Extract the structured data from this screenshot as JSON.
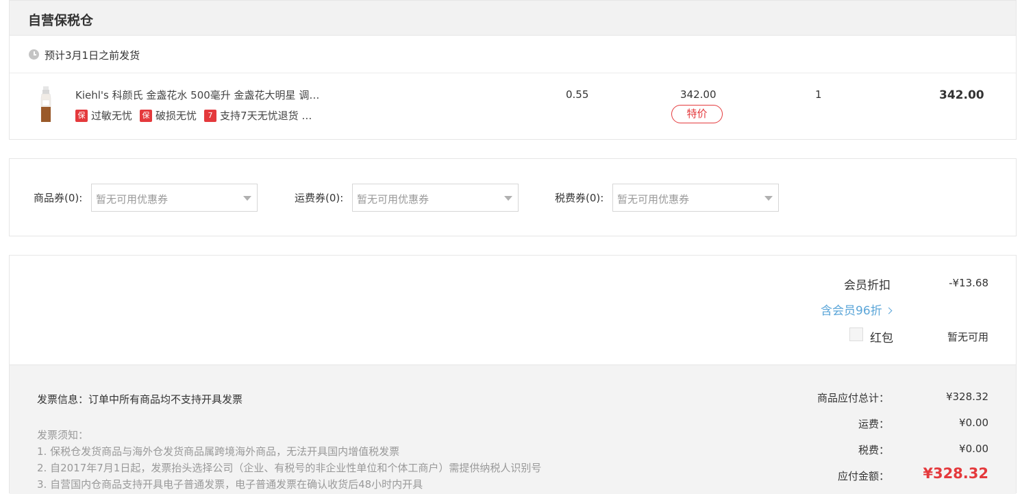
{
  "warehouse": {
    "title": "自营保税仓",
    "shipping_estimate": "预计3月1日之前发货"
  },
  "product": {
    "name": "Kiehl's 科颜氏 金盏花水 500毫升 金盏花大明星 调…",
    "tags": [
      {
        "badge": "保",
        "label": "过敏无忧"
      },
      {
        "badge": "保",
        "label": "破损无忧"
      },
      {
        "badge": "7",
        "label": "支持7天无忧退货 …"
      }
    ],
    "tax_rate": "0.55",
    "unit_price": "342.00",
    "special_badge": "特价",
    "quantity": "1",
    "subtotal": "342.00"
  },
  "coupons": [
    {
      "label": "商品券(0):",
      "placeholder": "暂无可用优惠券"
    },
    {
      "label": "运费券(0):",
      "placeholder": "暂无可用优惠券"
    },
    {
      "label": "税费券(0):",
      "placeholder": "暂无可用优惠券"
    }
  ],
  "summary": {
    "member_discount_label": "会员折扣",
    "member_discount_value": "-¥13.68",
    "member_link": "含会员96折",
    "redpack_label": "红包",
    "redpack_value": "暂无可用"
  },
  "invoice": {
    "info": "发票信息：订单中所有商品均不支持开具发票",
    "notice_title": "发票须知：",
    "notice_lines": [
      "1. 保税仓发货商品与海外仓发货商品属跨境海外商品，无法开具国内增值税发票",
      "2. 自2017年7月1日起，发票抬头选择公司（企业、有税号的非企业性单位和个体工商户）需提供纳税人识别号",
      "3. 自营国内仓商品支持开具电子普通发票，电子普通发票在确认收货后48小时内开具"
    ]
  },
  "totals": {
    "goods_total_label": "商品应付总计：",
    "goods_total_value": "¥328.32",
    "shipping_label": "运费：",
    "shipping_value": "¥0.00",
    "tax_label": "税费：",
    "tax_value": "¥0.00",
    "pay_label": "应付金额：",
    "pay_value": "¥328.32"
  },
  "colors": {
    "accent_red": "#e4393c",
    "link_blue": "#5aa5d8"
  }
}
